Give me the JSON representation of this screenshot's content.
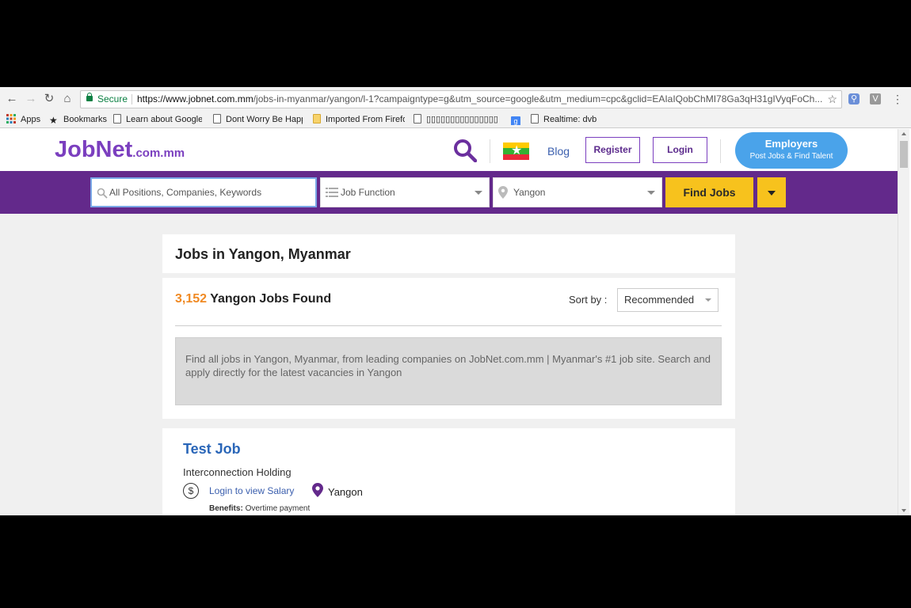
{
  "browser": {
    "secure_label": "Secure",
    "url_host": "https://www.jobnet.com.mm",
    "url_path": "/jobs-in-myanmar/yangon/l-1?campaigntype=g&utm_source=google&utm_medium=cpc&gclid=EAIaIQobChMI78Ga3qH31gIVyqFoCh...",
    "extension_v": "V",
    "bookmarks": [
      "Apps",
      "Bookmarks",
      "Learn about Google C",
      "Dont Worry Be Happ",
      "Imported From Firefo",
      "▯▯▯▯▯▯▯▯▯▯▯▯▯▯▯",
      "",
      "Realtime: dvb"
    ]
  },
  "header": {
    "logo_main": "JobNet",
    "logo_domain": ".com.mm",
    "blog_label": "Blog",
    "register_label": "Register",
    "login_label": "Login",
    "employers_title": "Employers",
    "employers_sub": "Post Jobs & Find Talent"
  },
  "search": {
    "keyword_placeholder": "All Positions, Companies, Keywords",
    "job_function_label": "Job Function",
    "location_value": "Yangon",
    "find_button": "Find Jobs"
  },
  "results": {
    "page_title": "Jobs in Yangon, Myanmar",
    "count": "3,152",
    "count_suffix": " Yangon Jobs Found",
    "sort_label": "Sort by :",
    "sort_value": "Recommended",
    "description": "Find all jobs in Yangon, Myanmar, from leading companies on JobNet.com.mm | Myanmar's #1 job site. Search and apply directly for the latest vacancies in Yangon"
  },
  "job": {
    "title": "Test Job",
    "company": "Interconnection Holding",
    "salary_link": "Login to view Salary",
    "location": "Yangon",
    "benefits_label": "Benefits:",
    "benefits_value": " Overtime payment"
  },
  "colors": {
    "brand_purple": "#63298b",
    "accent_orange": "#f08a24",
    "find_yellow": "#f7c21d",
    "employers_blue": "#4aa3ea"
  }
}
